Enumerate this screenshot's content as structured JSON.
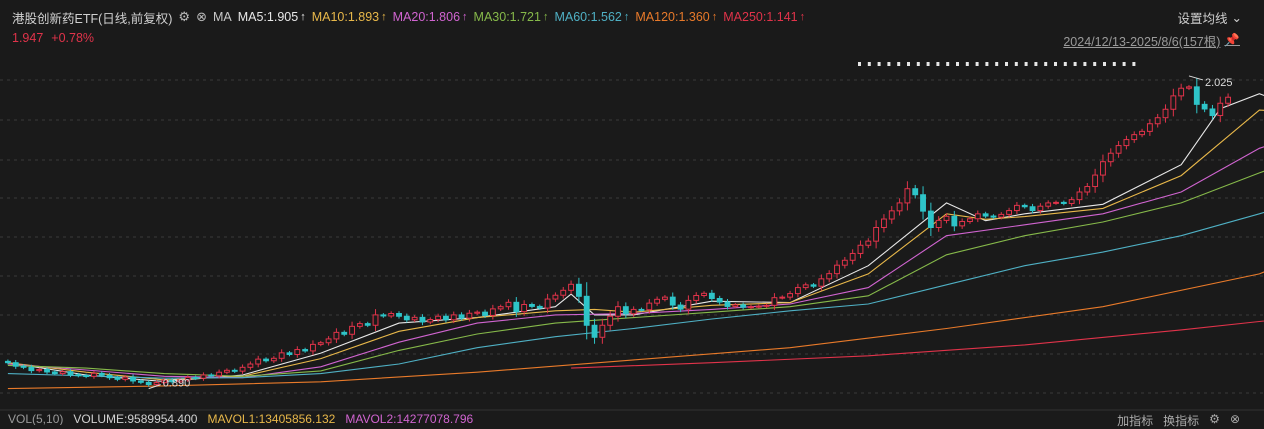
{
  "header": {
    "title": "港股创新药ETF(日线,前复权)",
    "ma_label": "MA",
    "ma_items": [
      {
        "label": "MA5:1.905",
        "color": "#e8e8e8"
      },
      {
        "label": "MA10:1.893",
        "color": "#e8b84a"
      },
      {
        "label": "MA20:1.806",
        "color": "#d064d0"
      },
      {
        "label": "MA30:1.721",
        "color": "#86b94a"
      },
      {
        "label": "MA60:1.562",
        "color": "#4fb0c4"
      },
      {
        "label": "MA120:1.360",
        "color": "#e87a2a"
      },
      {
        "label": "MA250:1.141",
        "color": "#e0334a"
      }
    ],
    "arrow_glyph": "↑",
    "settings_label": "设置均线",
    "price": "1.947",
    "change": "+0.78%",
    "range_label": "2024/12/13-2025/8/6(157根)"
  },
  "footer": {
    "vol_label": "VOL(5,10)",
    "volume": "VOLUME:9589954.400",
    "mavol1": "MAVOL1:13405856.132",
    "mavol2": "MAVOL2:14277078.796",
    "right_labels": [
      "加指标",
      "换指标"
    ]
  },
  "chart_data": {
    "type": "candlestick",
    "period": "2024/12/13-2025/8/6",
    "bar_count": 157,
    "annotations": [
      {
        "text": "2.025",
        "kind": "high"
      },
      {
        "text": "0.890",
        "kind": "low"
      }
    ],
    "colors": {
      "up": "#e0334a",
      "down": "#2ec4c8"
    },
    "ylim": [
      0.82,
      2.12
    ],
    "ma_series": [
      {
        "name": "MA5",
        "color": "#e8e8e8"
      },
      {
        "name": "MA10",
        "color": "#e8b84a"
      },
      {
        "name": "MA20",
        "color": "#d064d0"
      },
      {
        "name": "MA30",
        "color": "#86b94a"
      },
      {
        "name": "MA60",
        "color": "#4fb0c4"
      },
      {
        "name": "MA120",
        "color": "#e87a2a"
      },
      {
        "name": "MA250",
        "color": "#e0334a"
      }
    ],
    "closes": [
      0.975,
      0.962,
      0.958,
      0.946,
      0.95,
      0.941,
      0.935,
      0.942,
      0.931,
      0.928,
      0.925,
      0.936,
      0.929,
      0.92,
      0.914,
      0.922,
      0.908,
      0.903,
      0.895,
      0.902,
      0.911,
      0.905,
      0.912,
      0.921,
      0.918,
      0.93,
      0.927,
      0.94,
      0.947,
      0.944,
      0.958,
      0.97,
      0.988,
      0.982,
      0.991,
      1.011,
      1.005,
      1.023,
      1.018,
      1.042,
      1.048,
      1.062,
      1.086,
      1.079,
      1.108,
      1.118,
      1.112,
      1.15,
      1.146,
      1.155,
      1.145,
      1.132,
      1.141,
      1.124,
      1.133,
      1.145,
      1.132,
      1.15,
      1.138,
      1.156,
      1.16,
      1.148,
      1.172,
      1.18,
      1.196,
      1.162,
      1.188,
      1.181,
      1.175,
      1.208,
      1.222,
      1.24,
      1.262,
      1.218,
      1.112,
      1.068,
      1.112,
      1.145,
      1.18,
      1.154,
      1.17,
      1.169,
      1.193,
      1.207,
      1.215,
      1.186,
      1.171,
      1.203,
      1.221,
      1.229,
      1.21,
      1.197,
      1.181,
      1.187,
      1.178,
      1.18,
      1.182,
      1.185,
      1.213,
      1.215,
      1.228,
      1.25,
      1.26,
      1.255,
      1.282,
      1.301,
      1.332,
      1.35,
      1.375,
      1.405,
      1.42,
      1.47,
      1.501,
      1.531,
      1.56,
      1.612,
      1.59,
      1.53,
      1.47,
      1.496,
      1.511,
      1.476,
      1.492,
      1.502,
      1.52,
      1.512,
      1.508,
      1.518,
      1.532,
      1.551,
      1.546,
      1.532,
      1.548,
      1.56,
      1.562,
      1.558,
      1.572,
      1.6,
      1.62,
      1.662,
      1.711,
      1.742,
      1.77,
      1.792,
      1.81,
      1.822,
      1.85,
      1.872,
      1.903,
      1.952,
      1.98,
      1.985,
      1.921,
      1.904,
      1.88,
      1.925,
      1.947
    ],
    "ma_lines": {
      "MA5": [
        [
          0,
          0.975
        ],
        [
          10,
          0.93
        ],
        [
          20,
          0.906
        ],
        [
          30,
          0.93
        ],
        [
          40,
          1.01
        ],
        [
          50,
          1.12
        ],
        [
          60,
          1.14
        ],
        [
          70,
          1.18
        ],
        [
          72,
          1.226
        ],
        [
          75,
          1.15
        ],
        [
          80,
          1.15
        ],
        [
          90,
          1.2
        ],
        [
          100,
          1.195
        ],
        [
          110,
          1.33
        ],
        [
          120,
          1.56
        ],
        [
          125,
          1.495
        ],
        [
          130,
          1.52
        ],
        [
          140,
          1.555
        ],
        [
          150,
          1.7
        ],
        [
          155,
          1.905
        ],
        [
          160,
          1.96
        ],
        [
          165,
          1.905
        ]
      ],
      "MA10": [
        [
          0,
          0.975
        ],
        [
          10,
          0.94
        ],
        [
          20,
          0.912
        ],
        [
          30,
          0.925
        ],
        [
          40,
          0.99
        ],
        [
          50,
          1.09
        ],
        [
          60,
          1.14
        ],
        [
          70,
          1.165
        ],
        [
          75,
          1.17
        ],
        [
          80,
          1.16
        ],
        [
          90,
          1.185
        ],
        [
          100,
          1.195
        ],
        [
          110,
          1.3
        ],
        [
          120,
          1.52
        ],
        [
          125,
          1.5
        ],
        [
          130,
          1.51
        ],
        [
          140,
          1.54
        ],
        [
          150,
          1.66
        ],
        [
          160,
          1.9
        ],
        [
          165,
          1.893
        ]
      ],
      "MA20": [
        [
          0,
          0.97
        ],
        [
          10,
          0.948
        ],
        [
          20,
          0.925
        ],
        [
          30,
          0.92
        ],
        [
          40,
          0.96
        ],
        [
          50,
          1.05
        ],
        [
          60,
          1.12
        ],
        [
          70,
          1.15
        ],
        [
          80,
          1.155
        ],
        [
          90,
          1.17
        ],
        [
          100,
          1.19
        ],
        [
          110,
          1.25
        ],
        [
          120,
          1.44
        ],
        [
          130,
          1.48
        ],
        [
          140,
          1.52
        ],
        [
          150,
          1.6
        ],
        [
          160,
          1.76
        ],
        [
          165,
          1.806
        ]
      ],
      "MA30": [
        [
          0,
          0.965
        ],
        [
          10,
          0.955
        ],
        [
          20,
          0.935
        ],
        [
          30,
          0.925
        ],
        [
          40,
          0.945
        ],
        [
          50,
          1.02
        ],
        [
          60,
          1.08
        ],
        [
          70,
          1.12
        ],
        [
          80,
          1.14
        ],
        [
          90,
          1.16
        ],
        [
          100,
          1.18
        ],
        [
          110,
          1.22
        ],
        [
          120,
          1.37
        ],
        [
          130,
          1.44
        ],
        [
          140,
          1.49
        ],
        [
          150,
          1.56
        ],
        [
          160,
          1.67
        ],
        [
          165,
          1.721
        ]
      ],
      "MA60": [
        [
          0,
          0.935
        ],
        [
          20,
          0.918
        ],
        [
          30,
          0.92
        ],
        [
          40,
          0.935
        ],
        [
          50,
          0.97
        ],
        [
          60,
          1.03
        ],
        [
          70,
          1.07
        ],
        [
          80,
          1.1
        ],
        [
          90,
          1.135
        ],
        [
          100,
          1.165
        ],
        [
          110,
          1.19
        ],
        [
          120,
          1.26
        ],
        [
          130,
          1.33
        ],
        [
          140,
          1.38
        ],
        [
          150,
          1.44
        ],
        [
          160,
          1.52
        ],
        [
          165,
          1.562
        ]
      ],
      "MA120": [
        [
          0,
          0.88
        ],
        [
          20,
          0.89
        ],
        [
          40,
          0.905
        ],
        [
          60,
          0.94
        ],
        [
          80,
          0.985
        ],
        [
          100,
          1.03
        ],
        [
          120,
          1.1
        ],
        [
          140,
          1.18
        ],
        [
          160,
          1.3
        ],
        [
          165,
          1.36
        ]
      ],
      "MA250": [
        [
          72,
          0.955
        ],
        [
          90,
          0.975
        ],
        [
          110,
          1.0
        ],
        [
          130,
          1.04
        ],
        [
          150,
          1.095
        ],
        [
          165,
          1.141
        ]
      ]
    }
  }
}
